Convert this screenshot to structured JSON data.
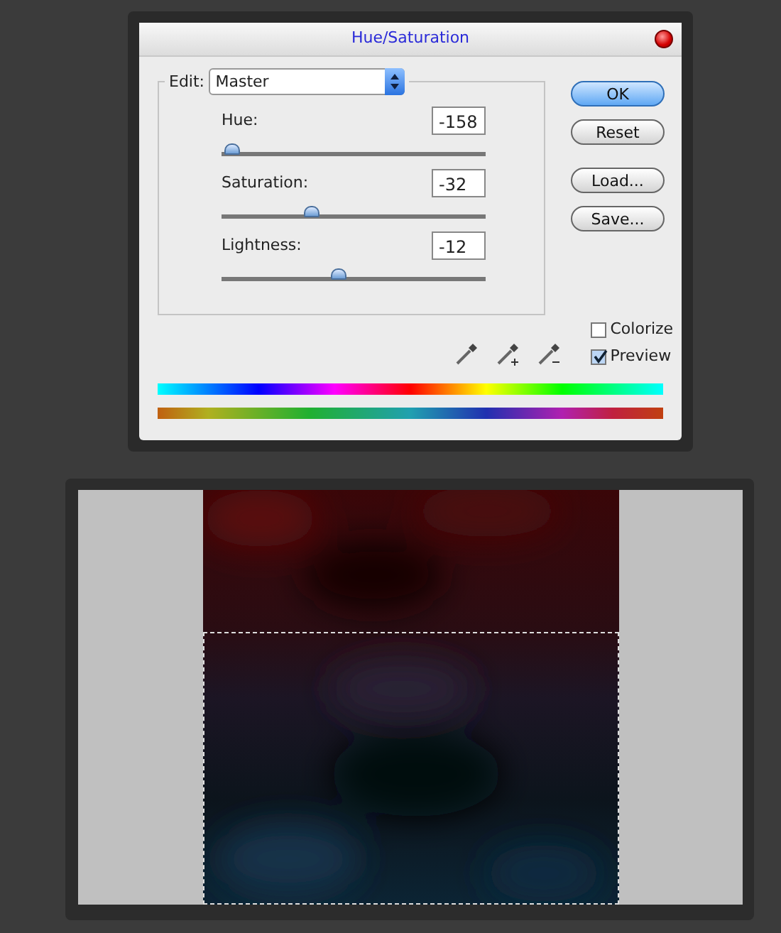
{
  "dialog": {
    "title": "Hue/Saturation",
    "edit": {
      "label": "Edit:",
      "value": "Master"
    },
    "sliders": [
      {
        "label": "Hue:",
        "value": "-158",
        "level": 0.04
      },
      {
        "label": "Saturation:",
        "value": "-32",
        "level": 0.34
      },
      {
        "label": "Lightness:",
        "value": "-12",
        "level": 0.44
      }
    ],
    "buttons": [
      {
        "label": "OK",
        "default": true
      },
      {
        "label": "Reset",
        "default": false
      },
      {
        "label": "Load...",
        "default": false
      },
      {
        "label": "Save...",
        "default": false
      }
    ],
    "checkboxes": [
      {
        "label": "Colorize",
        "checked": false
      },
      {
        "label": "Preview",
        "checked": true
      }
    ],
    "eyedroppers": [
      {
        "kind": "plain"
      },
      {
        "kind": "add"
      },
      {
        "kind": "subtract"
      }
    ]
  },
  "canvas": {
    "selection": true
  }
}
